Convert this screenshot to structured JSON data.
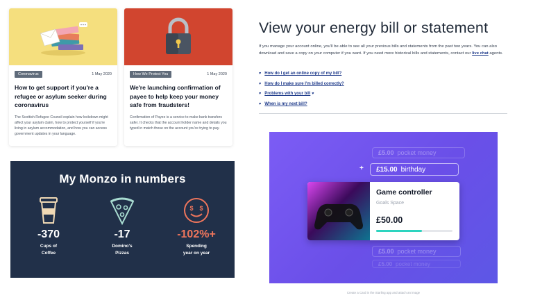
{
  "cards": [
    {
      "tag": "Coronavirus",
      "date": "1 May 2020",
      "title": "How to get support if you're a refugee or asylum seeker during coronavirus",
      "body": "The Scottish Refugee Council explain how lockdown might affect your asylum claim, how to protect yourself if you're living in asylum accommodation, and how you can access government updates in your language.",
      "hero_color": "#f5df7e"
    },
    {
      "tag": "How We Protect You",
      "date": "1 May 2020",
      "title": "We're launching confirmation of payee to help keep your money safe from fraudsters!",
      "body": "Confirmation of Payee is a service to make bank transfers safer. It checks that the account holder name and details you typed in match those on the account you're trying to pay.",
      "hero_color": "#d1452f"
    }
  ],
  "monzo": {
    "title": "My Monzo in numbers",
    "stats": [
      {
        "value": "-370",
        "label_line1": "Cups of",
        "label_line2": "Coffee",
        "icon": "coffee-cup-icon"
      },
      {
        "value": "-17",
        "label_line1": "Domino's",
        "label_line2": "Pizzas",
        "icon": "pizza-slice-icon"
      },
      {
        "value": "-102%+",
        "label_line1": "Spending",
        "label_line2": "year on year",
        "icon": "money-face-icon"
      }
    ],
    "accent": "#f0765c"
  },
  "article": {
    "title": "View your energy bill or statement",
    "intro_text": "If you manage your account online, you'll be able to see all your previous bills and statements from the past two years. You can also download and save a copy on your computer if you want. If you need more historical bills and statements, contact our",
    "intro_link": "live chat",
    "intro_suffix": "agents.",
    "links": [
      "How do I get an online copy of my bill?",
      "How do I make sure I'm billed correctly?",
      "Problems with your bill",
      "When is my next bill?"
    ]
  },
  "goal": {
    "pills": [
      {
        "amount": "£5.00",
        "label": "pocket money"
      },
      {
        "amount": "£15.00",
        "label": "birthday"
      },
      {
        "amount": "£5.00",
        "label": "pocket money"
      },
      {
        "amount": "£5.00",
        "label": "pocket money"
      }
    ],
    "plus": "+",
    "card_name": "Game controller",
    "card_sub": "Goals Space",
    "card_amount": "£50.00",
    "progress": 0.6,
    "caption": "Create a Card in the Starling app and attach an image"
  }
}
